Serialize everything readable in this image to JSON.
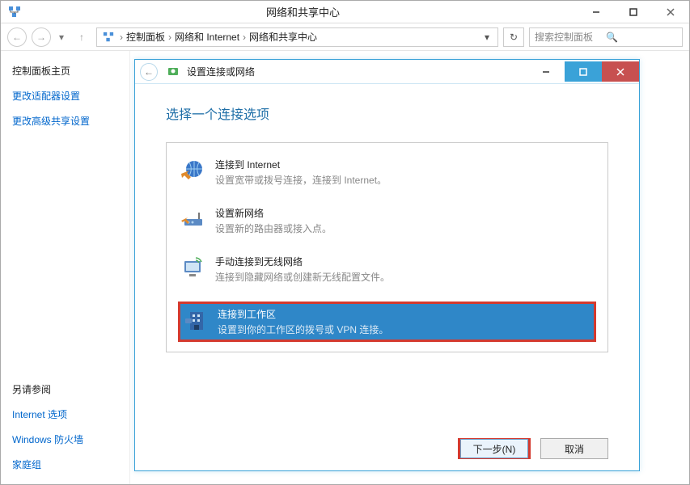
{
  "outer": {
    "title": "网络和共享中心",
    "search_placeholder": "搜索控制面板"
  },
  "breadcrumb": {
    "items": [
      "控制面板",
      "网络和 Internet",
      "网络和共享中心"
    ]
  },
  "sidebar": {
    "title": "控制面板主页",
    "links_top": [
      "更改适配器设置",
      "更改高级共享设置"
    ],
    "section_title": "另请参阅",
    "links_bottom": [
      "Internet 选项",
      "Windows 防火墙",
      "家庭组"
    ]
  },
  "wizard": {
    "title": "设置连接或网络",
    "heading": "选择一个连接选项",
    "options": [
      {
        "title": "连接到 Internet",
        "desc": "设置宽带或拨号连接，连接到 Internet。",
        "icon": "globe"
      },
      {
        "title": "设置新网络",
        "desc": "设置新的路由器或接入点。",
        "icon": "router"
      },
      {
        "title": "手动连接到无线网络",
        "desc": "连接到隐藏网络或创建新无线配置文件。",
        "icon": "wifi"
      },
      {
        "title": "连接到工作区",
        "desc": "设置到你的工作区的拨号或 VPN 连接。",
        "icon": "workplace"
      }
    ],
    "selected_index": 3,
    "buttons": {
      "next": "下一步(N)",
      "cancel": "取消"
    }
  }
}
